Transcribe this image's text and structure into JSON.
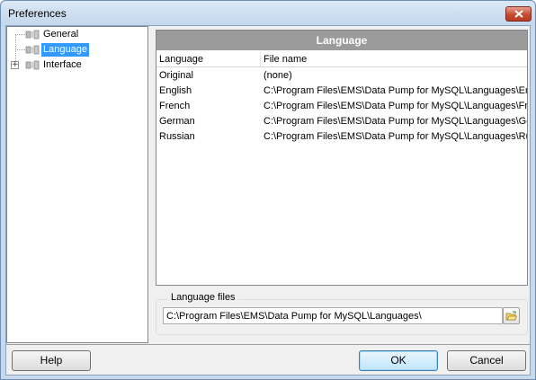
{
  "window": {
    "title": "Preferences"
  },
  "tree": {
    "items": [
      {
        "label": "General",
        "selected": false,
        "expandable": false
      },
      {
        "label": "Language",
        "selected": true,
        "expandable": false
      },
      {
        "label": "Interface",
        "selected": false,
        "expandable": true
      }
    ]
  },
  "panel": {
    "header": "Language",
    "columns": [
      "Language",
      "File name"
    ],
    "rows": [
      {
        "language": "Original",
        "file": "(none)"
      },
      {
        "language": "English",
        "file": "C:\\Program Files\\EMS\\Data Pump for MySQL\\Languages\\En"
      },
      {
        "language": "French",
        "file": "C:\\Program Files\\EMS\\Data Pump for MySQL\\Languages\\Fre"
      },
      {
        "language": "German",
        "file": "C:\\Program Files\\EMS\\Data Pump for MySQL\\Languages\\Ge"
      },
      {
        "language": "Russian",
        "file": "C:\\Program Files\\EMS\\Data Pump for MySQL\\Languages\\Ru"
      }
    ]
  },
  "language_files": {
    "group_label": "Language files",
    "path": "C:\\Program Files\\EMS\\Data Pump for MySQL\\Languages\\"
  },
  "buttons": {
    "help": "Help",
    "ok": "OK",
    "cancel": "Cancel"
  },
  "icons": {
    "close": "close-icon",
    "tree_node": "tree-node-icon",
    "browse": "folder-open-icon"
  },
  "colors": {
    "selection": "#3399ff",
    "panel_header": "#9b9b9b",
    "close_button": "#c64b33"
  }
}
